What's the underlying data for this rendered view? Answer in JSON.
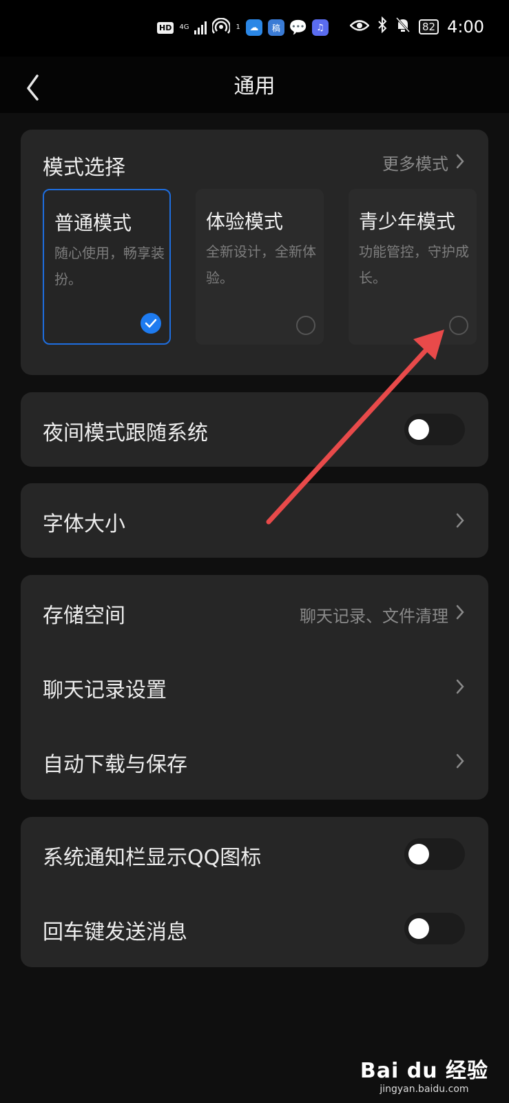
{
  "status_bar": {
    "hd": "HD",
    "network": "4G",
    "hotspot_count": "1",
    "app_icons": [
      "cloud-icon",
      "draft-app-icon",
      "chat-bubble-icon",
      "music-icon"
    ],
    "battery": "82",
    "time": "4:00"
  },
  "nav": {
    "title": "通用"
  },
  "mode_section": {
    "title": "模式选择",
    "more_label": "更多模式",
    "modes": [
      {
        "name": "普通模式",
        "desc": "随心使用，畅享装扮。",
        "selected": true
      },
      {
        "name": "体验模式",
        "desc": "全新设计，全新体验。",
        "selected": false
      },
      {
        "name": "青少年模式",
        "desc": "功能管控，守护成长。",
        "selected": false
      }
    ]
  },
  "night_mode": {
    "label": "夜间模式跟随系统",
    "on": false
  },
  "font_size": {
    "label": "字体大小"
  },
  "storage_group": {
    "storage": {
      "label": "存储空间",
      "hint": "聊天记录、文件清理"
    },
    "chat_history": {
      "label": "聊天记录设置"
    },
    "auto_download": {
      "label": "自动下载与保存"
    }
  },
  "toggle_group": {
    "qq_icon": {
      "label": "系统通知栏显示QQ图标",
      "on": false
    },
    "enter_send": {
      "label": "回车键发送消息",
      "on": false
    }
  },
  "watermark": {
    "logo": "Bai du 经验",
    "url": "jingyan.baidu.com"
  },
  "colors": {
    "accent": "#1e7bf0",
    "card": "#262626",
    "annotation_arrow": "#e84a4a"
  }
}
